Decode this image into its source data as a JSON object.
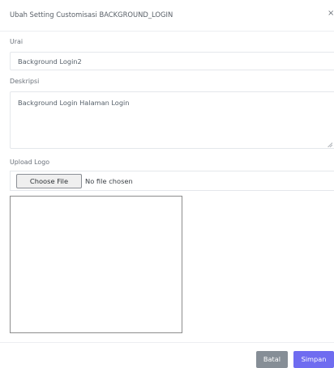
{
  "modal": {
    "title": "Ubah Setting Customisasi BACKGROUND_LOGIN",
    "close_symbol": "×"
  },
  "form": {
    "urai": {
      "label": "Urai",
      "value": "Background Login2"
    },
    "deskripsi": {
      "label": "Deskripsi",
      "value": "Background Login Halaman Login"
    },
    "upload": {
      "label": "Upload Logo",
      "button_label": "Choose File",
      "status_text": "No file chosen"
    }
  },
  "footer": {
    "cancel_label": "Batal",
    "save_label": "Simpan"
  },
  "colors": {
    "cancel_button": "#868e96",
    "save_button": "#6f6cf0"
  }
}
